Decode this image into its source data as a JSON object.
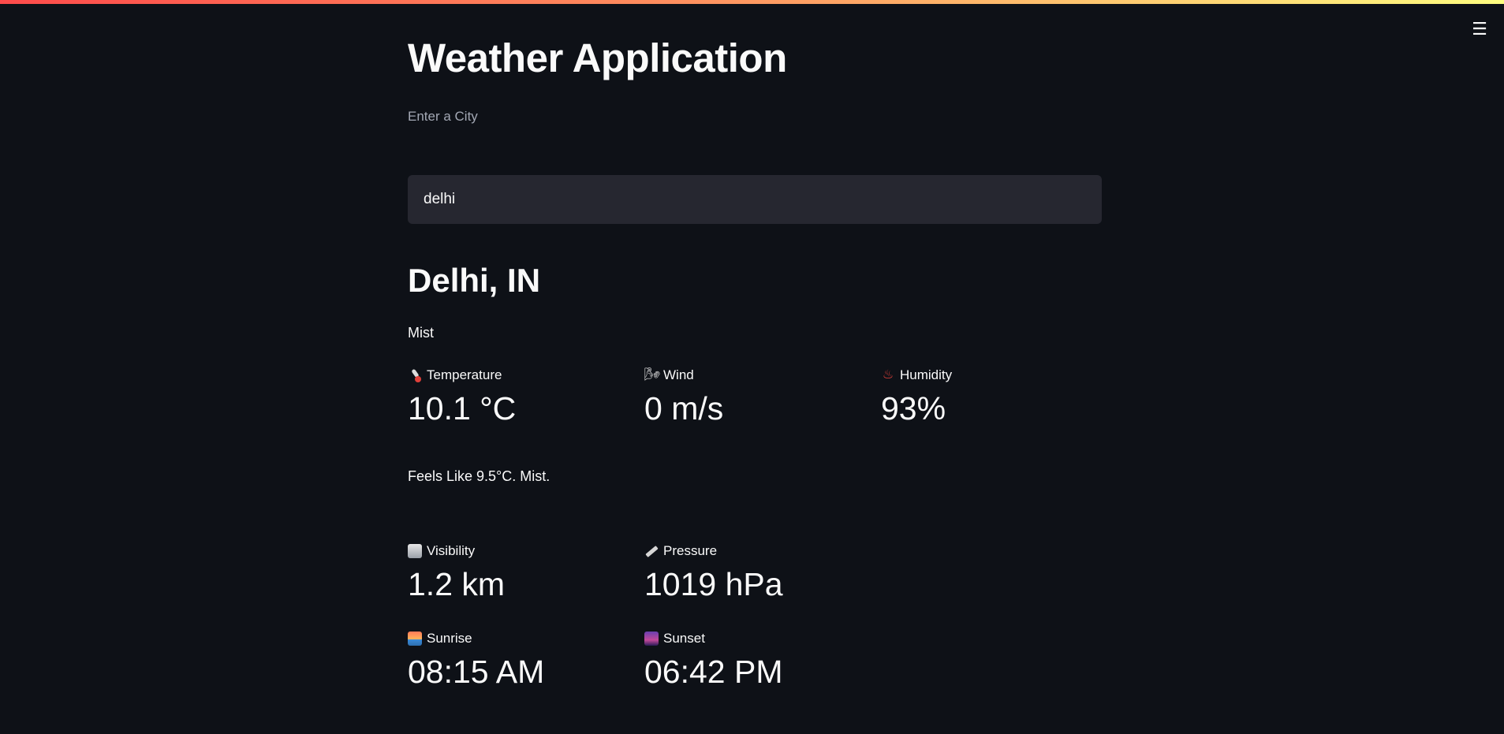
{
  "app": {
    "title": "Weather Application",
    "menu_icon": "hamburger-menu-icon",
    "accent_gradient": [
      "#ff4b4b",
      "#fffd80"
    ]
  },
  "search": {
    "label": "Enter a City",
    "value": "delhi"
  },
  "location": {
    "name": "Delhi, IN",
    "description": "Mist"
  },
  "metrics_row1": [
    {
      "icon": "thermometer-icon",
      "glyph": "",
      "label": "Temperature",
      "value": "10.1 °C"
    },
    {
      "icon": "wind-icon",
      "glyph": "🌬",
      "label": "Wind",
      "value": "0 m/s"
    },
    {
      "icon": "humidity-icon",
      "glyph": "♨",
      "label": "Humidity",
      "value": "93%"
    }
  ],
  "feels_like": "Feels Like 9.5°C. Mist.",
  "metrics_row2": [
    {
      "icon": "visibility-icon",
      "label": "Visibility",
      "value": "1.2 km"
    },
    {
      "icon": "ruler-icon",
      "label": "Pressure",
      "value": "1019 hPa"
    }
  ],
  "metrics_row3": [
    {
      "icon": "sunrise-icon",
      "label": "Sunrise",
      "value": "08:15 AM"
    },
    {
      "icon": "sunset-icon",
      "label": "Sunset",
      "value": "06:42 PM"
    }
  ]
}
